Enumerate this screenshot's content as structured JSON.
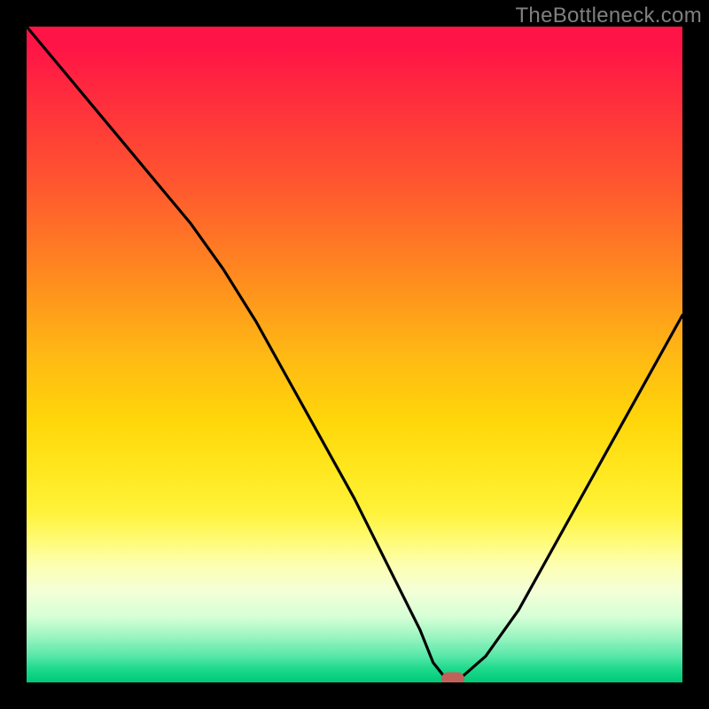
{
  "watermark": "TheBottleneck.com",
  "chart_data": {
    "type": "line",
    "title": "",
    "xlabel": "",
    "ylabel": "",
    "xlim": [
      0,
      100
    ],
    "ylim": [
      0,
      100
    ],
    "grid": false,
    "series": [
      {
        "name": "bottleneck-curve",
        "x": [
          0,
          5,
          10,
          15,
          20,
          25,
          30,
          35,
          40,
          45,
          50,
          55,
          60,
          62,
          64,
          66,
          70,
          75,
          80,
          85,
          90,
          95,
          100
        ],
        "values": [
          100,
          94,
          88,
          82,
          76,
          70,
          63,
          55,
          46,
          37,
          28,
          18,
          8,
          3,
          0.5,
          0.5,
          4,
          11,
          20,
          29,
          38,
          47,
          56
        ]
      }
    ],
    "marker": {
      "x": 65,
      "y": 0.5,
      "color": "#c1625a"
    },
    "gradient_stops": [
      {
        "pos": 0,
        "color": "#ff1447"
      },
      {
        "pos": 25,
        "color": "#ff5a2e"
      },
      {
        "pos": 50,
        "color": "#ffb814"
      },
      {
        "pos": 74,
        "color": "#fff23a"
      },
      {
        "pos": 90,
        "color": "#d6ffd6"
      },
      {
        "pos": 100,
        "color": "#00c878"
      }
    ]
  }
}
